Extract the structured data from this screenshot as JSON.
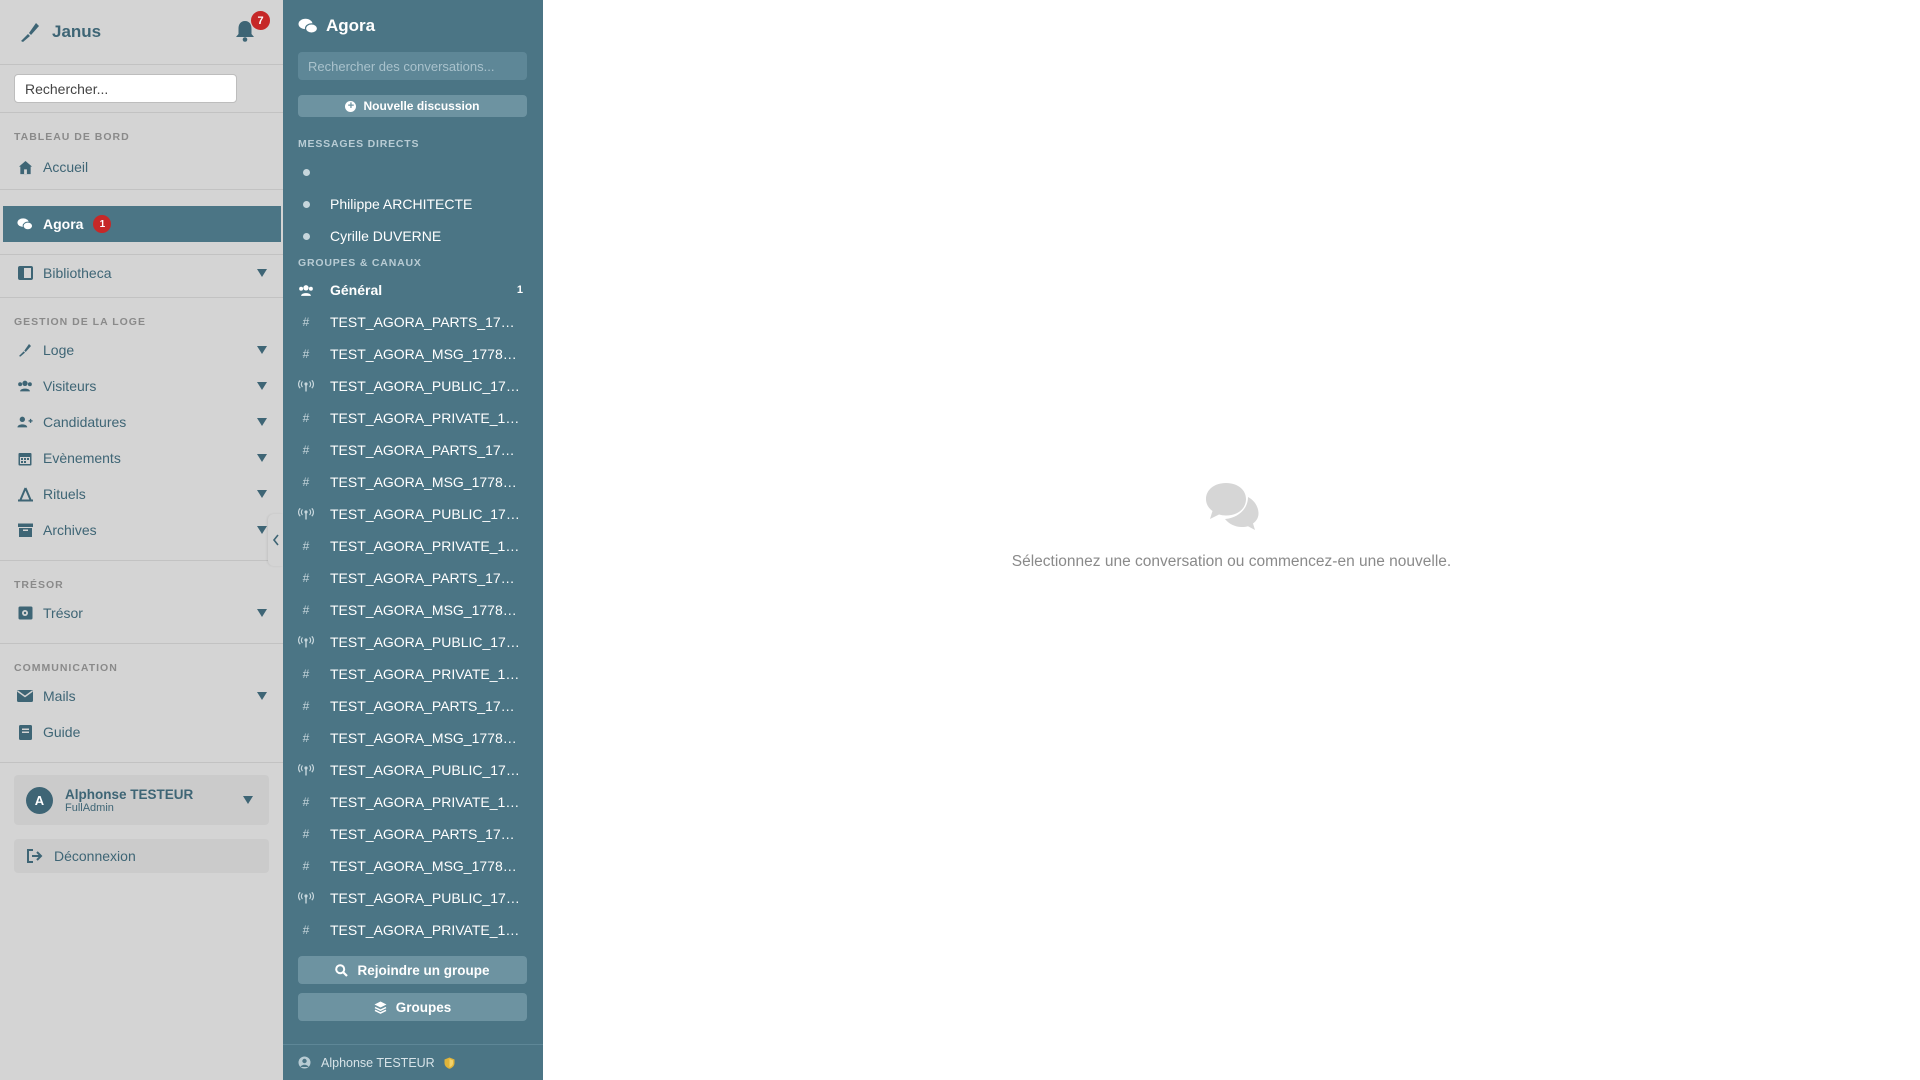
{
  "brand": {
    "name": "Janus"
  },
  "notifications": {
    "count": "7"
  },
  "search": {
    "placeholder": "Rechercher..."
  },
  "sidebar": {
    "section_dashboard": "TABLEAU DE BORD",
    "home": "Accueil",
    "agora": "Agora",
    "agora_badge": "1",
    "bibliotheca": "Bibliotheca",
    "section_lodge": "GESTION DE LA LOGE",
    "loge": "Loge",
    "visiteurs": "Visiteurs",
    "candidatures": "Candidatures",
    "evenements": "Evènements",
    "rituels": "Rituels",
    "archives": "Archives",
    "section_treasury": "TRÉSOR",
    "tresor": "Trésor",
    "section_comm": "COMMUNICATION",
    "mails": "Mails",
    "guide": "Guide"
  },
  "user": {
    "initial": "A",
    "name": "Alphonse TESTEUR",
    "role": "FullAdmin"
  },
  "logout": "Déconnexion",
  "panel": {
    "title": "Agora",
    "search_placeholder": "Rechercher des conversations...",
    "new_discussion": "Nouvelle discussion",
    "direct_label": "MESSAGES DIRECTS",
    "direct": [
      "",
      "Philippe ARCHITECTE",
      "Cyrille DUVERNE"
    ],
    "groups_label": "GROUPES & CANAUX",
    "general": {
      "name": "Général",
      "count": "1"
    },
    "channels": [
      {
        "name": "TEST_AGORA_PARTS_1778...",
        "type": "hash"
      },
      {
        "name": "TEST_AGORA_MSG_177825...",
        "type": "hash"
      },
      {
        "name": "TEST_AGORA_PUBLIC_177...",
        "type": "broadcast"
      },
      {
        "name": "TEST_AGORA_PRIVATE_17...",
        "type": "hash"
      },
      {
        "name": "TEST_AGORA_PARTS_1778...",
        "type": "hash"
      },
      {
        "name": "TEST_AGORA_MSG_177825...",
        "type": "hash"
      },
      {
        "name": "TEST_AGORA_PUBLIC_177...",
        "type": "broadcast"
      },
      {
        "name": "TEST_AGORA_PRIVATE_17...",
        "type": "hash"
      },
      {
        "name": "TEST_AGORA_PARTS_1778...",
        "type": "hash"
      },
      {
        "name": "TEST_AGORA_MSG_177825...",
        "type": "hash"
      },
      {
        "name": "TEST_AGORA_PUBLIC_177...",
        "type": "broadcast"
      },
      {
        "name": "TEST_AGORA_PRIVATE_17...",
        "type": "hash"
      },
      {
        "name": "TEST_AGORA_PARTS_1778...",
        "type": "hash"
      },
      {
        "name": "TEST_AGORA_MSG_177825...",
        "type": "hash"
      },
      {
        "name": "TEST_AGORA_PUBLIC_177...",
        "type": "broadcast"
      },
      {
        "name": "TEST_AGORA_PRIVATE_17...",
        "type": "hash"
      },
      {
        "name": "TEST_AGORA_PARTS_1778...",
        "type": "hash"
      },
      {
        "name": "TEST_AGORA_MSG_177825...",
        "type": "hash"
      },
      {
        "name": "TEST_AGORA_PUBLIC_177...",
        "type": "broadcast"
      },
      {
        "name": "TEST_AGORA_PRIVATE_17...",
        "type": "hash"
      }
    ],
    "join_group": "Rejoindre un groupe",
    "groups": "Groupes",
    "footer_user": "Alphonse TESTEUR"
  },
  "main": {
    "empty_text": "Sélectionnez une conversation ou commencez-en une nouvelle."
  },
  "colors": {
    "sidebar_bg": "#d4d4d4",
    "accent": "#4b7585",
    "badge": "#c62828",
    "text_accent": "#3e6575"
  }
}
